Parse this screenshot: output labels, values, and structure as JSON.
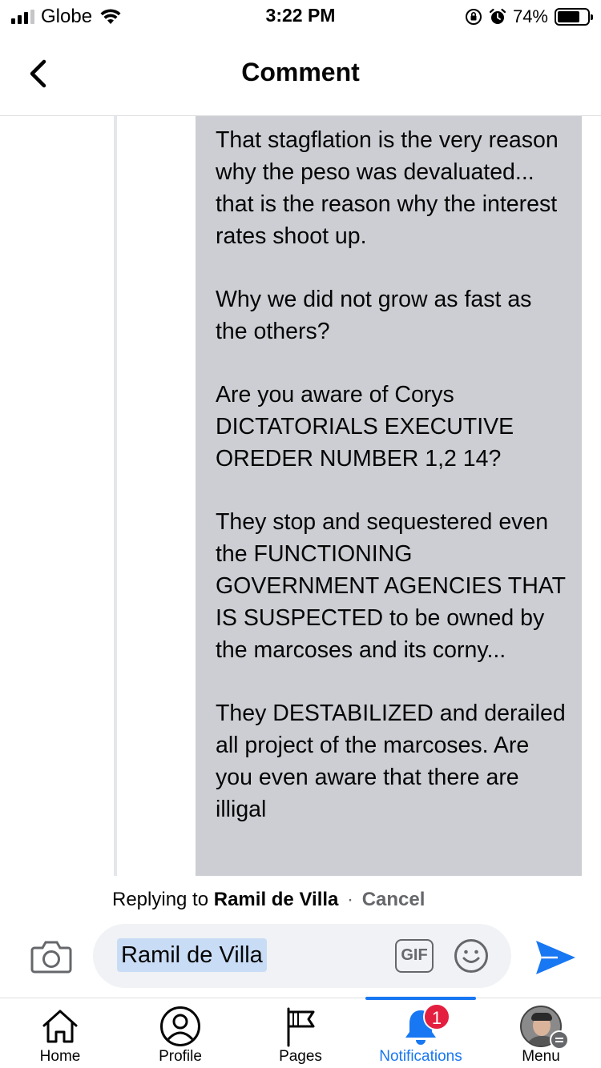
{
  "status_bar": {
    "carrier": "Globe",
    "time": "3:22 PM",
    "battery": "74%",
    "battery_level": 0.74,
    "icons": [
      "signal-icon",
      "wifi-icon",
      "orientation-lock-icon",
      "alarm-icon",
      "battery-icon"
    ]
  },
  "header": {
    "title": "Comment",
    "back_icon": "chevron-left-icon"
  },
  "comment": {
    "paragraphs": [
      "That stagflation is the very reason why the peso was devaluated... that is the reason why the interest rates shoot up.",
      "Why we did not grow as fast as the others?",
      "Are you aware of Corys DICTATORIALS EXECUTIVE OREDER NUMBER 1,2 14?",
      "They stop and sequestered even the FUNCTIONING GOVERNMENT AGENCIES THAT IS SUSPECTED to be owned by the marcoses and its corny...",
      "They DESTABILIZED and derailed all project of the marcoses. Are you even aware that there are illigal"
    ]
  },
  "reply": {
    "prefix": "Replying to",
    "name": "Ramil de Villa",
    "separator": "·",
    "cancel": "Cancel",
    "input_mention": "Ramil de Villa",
    "gif_label": "GIF",
    "icons": [
      "camera-icon",
      "gif-icon",
      "emoji-icon",
      "send-icon"
    ]
  },
  "tabs": [
    {
      "label": "Home",
      "icon": "home-icon",
      "active": false
    },
    {
      "label": "Profile",
      "icon": "profile-icon",
      "active": false
    },
    {
      "label": "Pages",
      "icon": "flag-icon",
      "active": false
    },
    {
      "label": "Notifications",
      "icon": "bell-icon",
      "active": true,
      "badge": "1"
    },
    {
      "label": "Menu",
      "icon": "avatar",
      "active": false
    }
  ],
  "colors": {
    "accent": "#1877f2",
    "badge": "#e41e3f",
    "bubble": "#ccced3",
    "mention_highlight": "#c9dcf5"
  }
}
